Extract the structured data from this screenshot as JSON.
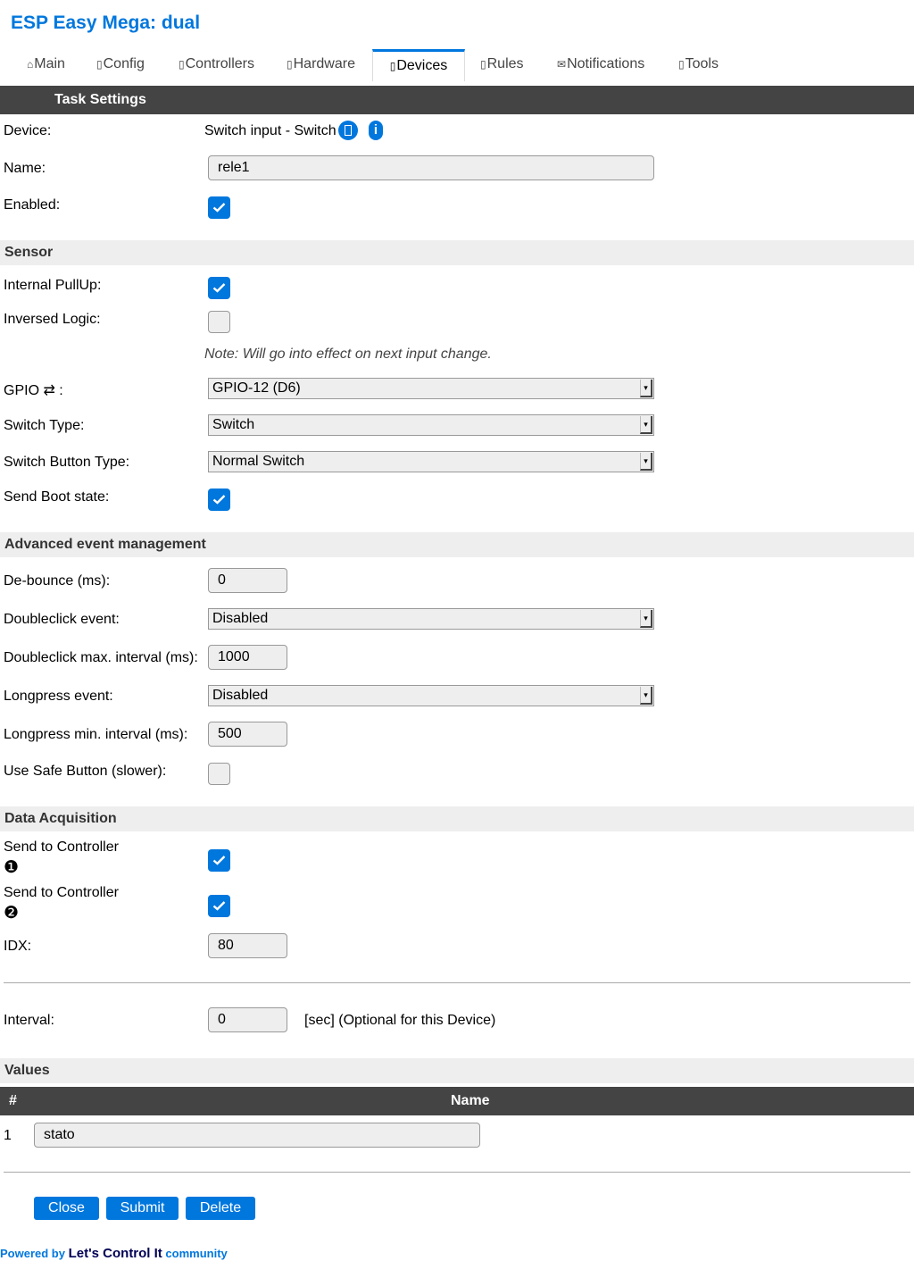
{
  "app": {
    "title": "ESP Easy Mega: dual"
  },
  "tabs": [
    {
      "icon": "⌂",
      "label": "Main"
    },
    {
      "icon": "",
      "label": "Config"
    },
    {
      "icon": "",
      "label": "Controllers"
    },
    {
      "icon": "",
      "label": "Hardware"
    },
    {
      "icon": "",
      "label": "Devices"
    },
    {
      "icon": "",
      "label": "Rules"
    },
    {
      "icon": "✉",
      "label": "Notifications"
    },
    {
      "icon": "",
      "label": "Tools"
    }
  ],
  "active_tab": "Devices",
  "task_settings": {
    "header": "Task Settings",
    "device_label": "Device:",
    "device_value": "Switch input - Switch",
    "name_label": "Name:",
    "name_value": "rele1",
    "enabled_label": "Enabled:",
    "enabled": true
  },
  "sensor": {
    "header": "Sensor",
    "pullup_label": "Internal PullUp:",
    "pullup": true,
    "inversed_label": "Inversed Logic:",
    "inversed": false,
    "note": "Note: Will go into effect on next input change.",
    "gpio_label": "GPIO ⇄ :",
    "gpio_value": "GPIO-12 (D6)",
    "switch_type_label": "Switch Type:",
    "switch_type_value": "Switch",
    "button_type_label": "Switch Button Type:",
    "button_type_value": "Normal Switch",
    "boot_state_label": "Send Boot state:",
    "boot_state": true
  },
  "advanced": {
    "header": "Advanced event management",
    "debounce_label": "De-bounce (ms):",
    "debounce_value": "0",
    "dblclick_label": "Doubleclick event:",
    "dblclick_value": "Disabled",
    "dblclick_interval_label": "Doubleclick max. interval (ms):",
    "dblclick_interval_value": "1000",
    "longpress_label": "Longpress event:",
    "longpress_value": "Disabled",
    "longpress_interval_label": "Longpress min. interval (ms):",
    "longpress_interval_value": "500",
    "safe_button_label": "Use Safe Button (slower):",
    "safe_button": false
  },
  "data_acquisition": {
    "header": "Data Acquisition",
    "controller1_label": "Send to Controller",
    "controller1_num": "❶",
    "controller1": true,
    "controller2_label": "Send to Controller",
    "controller2_num": "❷",
    "controller2": true,
    "idx_label": "IDX:",
    "idx_value": "80",
    "interval_label": "Interval:",
    "interval_value": "0",
    "interval_note": "[sec] (Optional for this Device)"
  },
  "values": {
    "header": "Values",
    "col_num": "#",
    "col_name": "Name",
    "rows": [
      {
        "num": "1",
        "name": "stato"
      }
    ]
  },
  "buttons": {
    "close": "Close",
    "submit": "Submit",
    "delete": "Delete"
  },
  "footer": {
    "prefix": "Powered by ",
    "brand": "Let's Control It",
    "suffix": " community"
  },
  "colors": {
    "accent": "#0077dd",
    "header_bg": "#444444",
    "section_bg": "#eeeeee"
  }
}
